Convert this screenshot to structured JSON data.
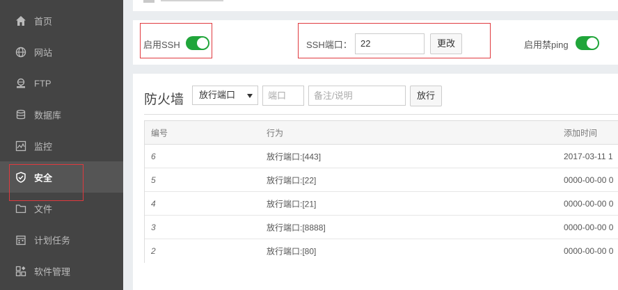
{
  "sidebar": {
    "items": [
      {
        "label": "首页",
        "icon": "home-icon"
      },
      {
        "label": "网站",
        "icon": "globe-icon"
      },
      {
        "label": "FTP",
        "icon": "ftp-icon"
      },
      {
        "label": "数据库",
        "icon": "database-icon"
      },
      {
        "label": "监控",
        "icon": "monitor-icon"
      },
      {
        "label": "安全",
        "icon": "shield-icon",
        "active": true
      },
      {
        "label": "文件",
        "icon": "folder-icon"
      },
      {
        "label": "计划任务",
        "icon": "calendar-icon"
      },
      {
        "label": "软件管理",
        "icon": "apps-icon"
      }
    ]
  },
  "ssh": {
    "enable_label": "启用SSH",
    "enabled": true,
    "port_label": "SSH端口：",
    "port_value": "22",
    "change_button": "更改",
    "ping_label": "启用禁ping",
    "ping_enabled": true
  },
  "firewall": {
    "title": "防火墙",
    "mode_select": "放行端口",
    "port_placeholder": "端口",
    "note_placeholder": "备注/说明",
    "allow_button": "放行",
    "columns": [
      "编号",
      "行为",
      "添加时间"
    ],
    "rows": [
      {
        "id": "6",
        "action": "放行端口:[443]",
        "time": "2017-03-11 1"
      },
      {
        "id": "5",
        "action": "放行端口:[22]",
        "time": "0000-00-00 0"
      },
      {
        "id": "4",
        "action": "放行端口:[21]",
        "time": "0000-00-00 0"
      },
      {
        "id": "3",
        "action": "放行端口:[8888]",
        "time": "0000-00-00 0"
      },
      {
        "id": "2",
        "action": "放行端口:[80]",
        "time": "0000-00-00 0"
      }
    ]
  },
  "colors": {
    "sidebar_bg": "#444444",
    "sidebar_active": "#555555",
    "toggle_on": "#20a53a",
    "highlight": "#e0393e"
  }
}
